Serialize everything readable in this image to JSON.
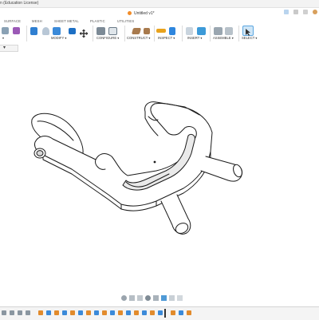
{
  "window": {
    "app_title": "n (Education License)",
    "document_title": "Untitled v1*"
  },
  "ribbon_tabs": [
    "SURFACE",
    "MESH",
    "SHEET METAL",
    "PLASTIC",
    "UTILITIES"
  ],
  "toolbar_groups": [
    "MODIFY ▾",
    "CONFIGURE ▾",
    "CONSTRUCT ▾",
    "INSPECT ▾",
    "INSERT ▾",
    "ASSEMBLE ▾",
    "SELECT ▾"
  ],
  "partial_labels": {
    "left_group_fragment": "▾",
    "browser_chevron": "▾"
  },
  "colors": {
    "accent_blue": "#1d7bd8",
    "selected_select": "#cfe6f7",
    "doc_tab_dot": "#f28c28",
    "model_line": "#1a1a1a",
    "model_shade": "#eaeaea"
  },
  "icons": {
    "toolbar": [
      "extrude-icon",
      "fillet-icon",
      "shell-icon",
      "combine-icon",
      "move-icon",
      "parameters-icon",
      "plane-icon",
      "measure-icon",
      "insert-image-icon",
      "joint-icon",
      "select-icon"
    ],
    "nav": [
      "orbit-icon",
      "look-at-icon",
      "pan-icon",
      "zoom-icon",
      "fit-icon",
      "display-settings-icon",
      "grid-icon",
      "viewports-icon"
    ]
  }
}
